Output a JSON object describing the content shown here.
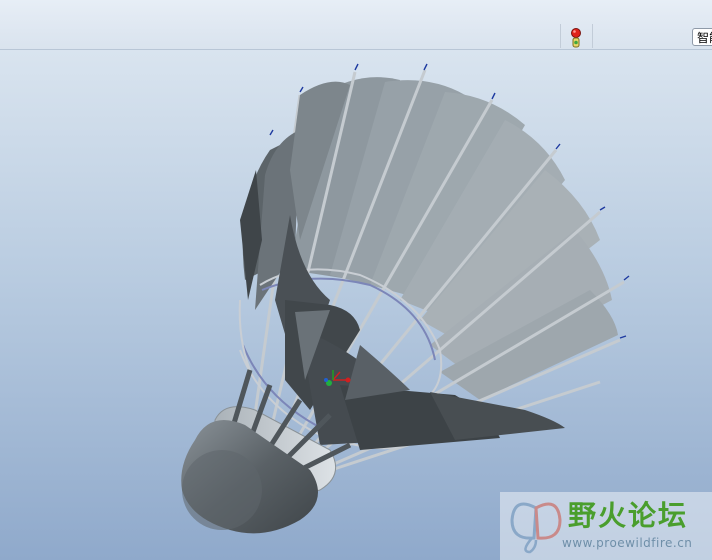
{
  "toolbar": {
    "status_icon": "traffic-light-icon",
    "smart_select_label": "智能"
  },
  "viewport": {
    "model": "badminton-shuttlecock",
    "csys_icon": "coordinate-system-icon"
  },
  "watermark": {
    "title": "野火论坛",
    "url": "www.proewildfire.cn",
    "logo_icon": "butterfly-logo"
  },
  "colors": {
    "background_top": "#d9e4ef",
    "background_bottom": "#8fa9cb",
    "feather_light": "#9ca7ae",
    "feather_dark": "#454b50",
    "watermark_green": "#4a9e2d"
  }
}
